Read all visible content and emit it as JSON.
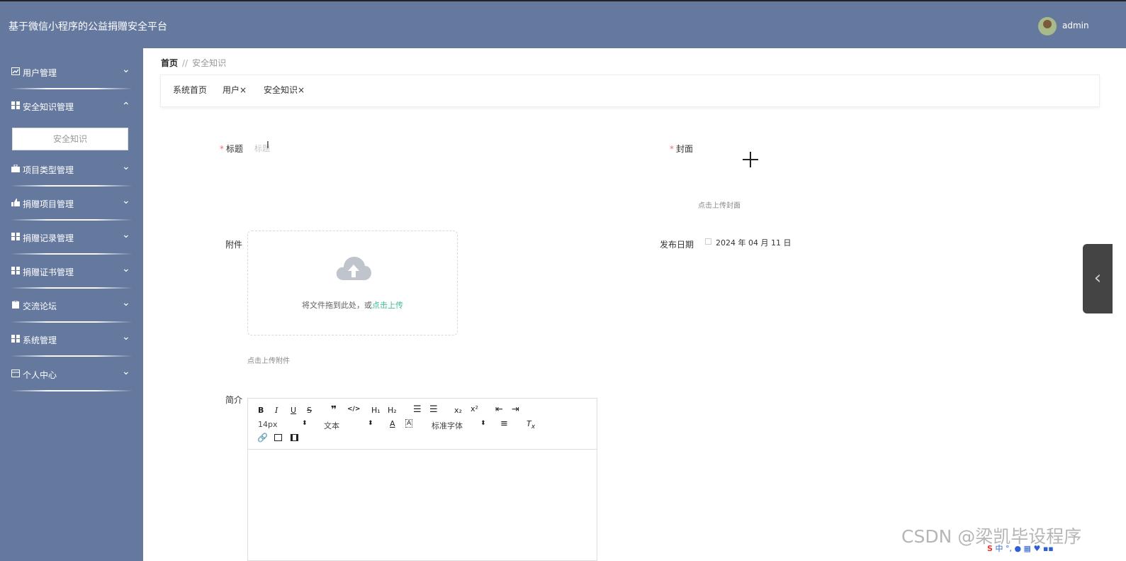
{
  "app": {
    "title": "基于微信小程序的公益捐赠安全平台",
    "user": "admin"
  },
  "sidebar": {
    "items": [
      {
        "label": "用户管理",
        "icon": "chart-icon",
        "expanded": false
      },
      {
        "label": "安全知识管理",
        "icon": "grid-icon",
        "expanded": true,
        "children": [
          "安全知识"
        ]
      },
      {
        "label": "项目类型管理",
        "icon": "briefcase-icon",
        "expanded": false
      },
      {
        "label": "捐赠项目管理",
        "icon": "thumbs-up-icon",
        "expanded": false
      },
      {
        "label": "捐赠记录管理",
        "icon": "grid-icon",
        "expanded": false
      },
      {
        "label": "捐赠证书管理",
        "icon": "grid-icon",
        "expanded": false
      },
      {
        "label": "交流论坛",
        "icon": "clipboard-icon",
        "expanded": false
      },
      {
        "label": "系统管理",
        "icon": "grid-icon",
        "expanded": false
      },
      {
        "label": "个人中心",
        "icon": "card-icon",
        "expanded": false
      }
    ]
  },
  "breadcrumb": {
    "home": "首页",
    "separator": "//",
    "current": "安全知识"
  },
  "tags": [
    {
      "label": "系统首页"
    },
    {
      "label": "用户×"
    },
    {
      "label": "安全知识×"
    }
  ],
  "form": {
    "title": {
      "label": "标题",
      "placeholder": "标题"
    },
    "cover": {
      "label": "封面",
      "hint": "点击上传封面"
    },
    "attachment": {
      "label": "附件",
      "drop_text": "将文件拖到此处，或",
      "drop_link": "点击上传",
      "hint": "点击上传附件"
    },
    "publish_date": {
      "label": "发布日期",
      "value": "2024 年 04 月 11 日"
    },
    "intro": {
      "label": "简介"
    }
  },
  "editor": {
    "font_size": "14px",
    "header_select": "文本",
    "font_family": "标准字体"
  },
  "watermark": "CSDN @梁凯毕设程序",
  "colors": {
    "sidebar": "#65799f",
    "accent": "#3fbf8f",
    "required": "#f56c6c"
  }
}
